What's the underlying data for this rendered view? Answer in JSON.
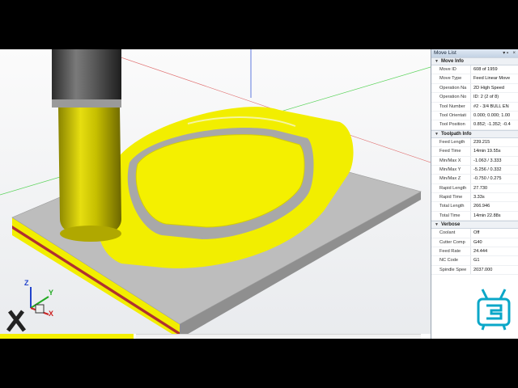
{
  "panel": {
    "title": "Move List",
    "controls": {
      "pin": "▾ ▪",
      "close": "×"
    },
    "sections": [
      {
        "header": "Move Info",
        "rows": [
          {
            "label": "Move ID",
            "value": "608 of 1959"
          },
          {
            "label": "Move Type",
            "value": "Feed Linear Move"
          },
          {
            "label": "Operation Na",
            "value": "2D High Speed"
          },
          {
            "label": "Operation No",
            "value": "ID: 2 (2 of 8)"
          },
          {
            "label": "Tool Number",
            "value": "#2 - 3/4 BULL EN"
          },
          {
            "label": "Tool Orientati",
            "value": "0.000; 0.000; 1.00"
          },
          {
            "label": "Tool Position",
            "value": "0.852; -1.352; -0.4"
          }
        ]
      },
      {
        "header": "Toolpath Info",
        "rows": [
          {
            "label": "Feed Length",
            "value": "239.215"
          },
          {
            "label": "Feed Time",
            "value": "14min 19.55s"
          },
          {
            "label": "Min/Max X",
            "value": "-1.063 / 3.333"
          },
          {
            "label": "Min/Max Y",
            "value": "-5.256 / 0.332"
          },
          {
            "label": "Min/Max Z",
            "value": "-0.750 / 0.275"
          },
          {
            "label": "Rapid Length",
            "value": "27.730"
          },
          {
            "label": "Rapid Time",
            "value": "3.33s"
          },
          {
            "label": "Total Length",
            "value": "266.946"
          },
          {
            "label": "Total Time",
            "value": "14min 22.88s"
          }
        ]
      },
      {
        "header": "Verbose",
        "rows": [
          {
            "label": "Coolant",
            "value": "Off"
          },
          {
            "label": "Cutter Comp",
            "value": "G40"
          },
          {
            "label": "Feed Rate",
            "value": "24.444"
          },
          {
            "label": "NC Code",
            "value": "G1"
          },
          {
            "label": "Spindle Spee",
            "value": "2037.000"
          }
        ]
      }
    ]
  },
  "triad": {
    "x": "X",
    "y": "Y",
    "z": "Z"
  },
  "colors": {
    "material": "#f2ee00",
    "stock": "#bdbdbd",
    "tool_body": "#c9c000",
    "tool_shank": "#4a4a4a"
  },
  "icons": {
    "axis_triad": "axis-triad-icon",
    "tv_logo": "tv-logo-icon",
    "section_toggle": "triangle-down-icon"
  }
}
